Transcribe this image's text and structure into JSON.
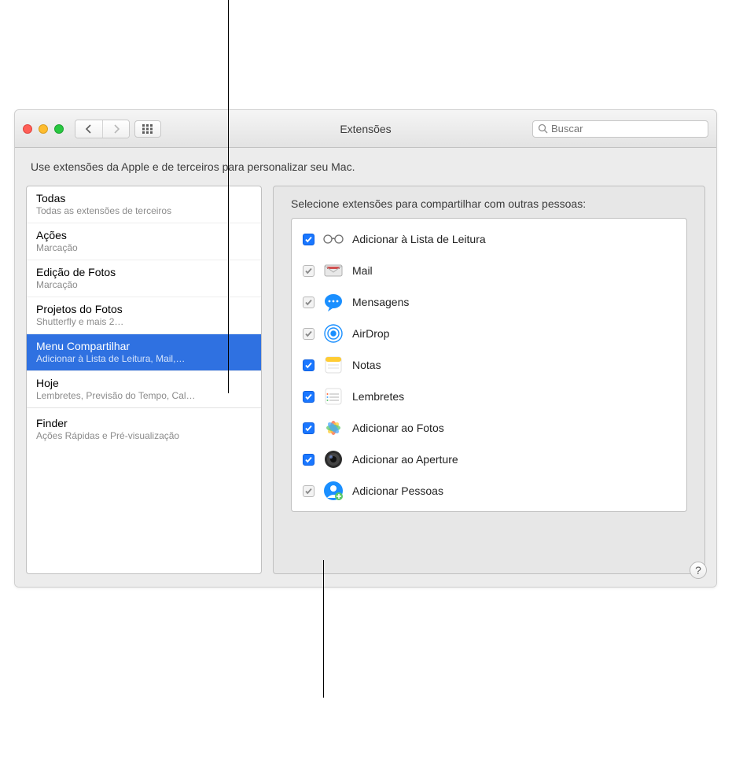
{
  "window": {
    "title": "Extensões",
    "search_placeholder": "Buscar"
  },
  "subheader": "Use extensões da Apple e de terceiros para personalizar seu Mac.",
  "sidebar": {
    "items": [
      {
        "title": "Todas",
        "subtitle": "Todas as extensões de terceiros"
      },
      {
        "title": "Ações",
        "subtitle": "Marcação"
      },
      {
        "title": "Edição de Fotos",
        "subtitle": "Marcação"
      },
      {
        "title": "Projetos do Fotos",
        "subtitle": "Shutterfly e mais 2…"
      },
      {
        "title": "Menu Compartilhar",
        "subtitle": "Adicionar à Lista de Leitura, Mail,…"
      },
      {
        "title": "Hoje",
        "subtitle": "Lembretes, Previsão do Tempo, Cal…"
      },
      {
        "title": "Finder",
        "subtitle": "Ações Rápidas e Pré-visualização"
      }
    ],
    "selected_index": 4
  },
  "main": {
    "header": "Selecione extensões para compartilhar com outras pessoas:",
    "extensions": [
      {
        "label": "Adicionar à Lista de Leitura",
        "checked": true,
        "locked": false,
        "icon": "glasses"
      },
      {
        "label": "Mail",
        "checked": true,
        "locked": true,
        "icon": "mail"
      },
      {
        "label": "Mensagens",
        "checked": true,
        "locked": true,
        "icon": "messages"
      },
      {
        "label": "AirDrop",
        "checked": true,
        "locked": true,
        "icon": "airdrop"
      },
      {
        "label": "Notas",
        "checked": true,
        "locked": false,
        "icon": "notes"
      },
      {
        "label": "Lembretes",
        "checked": true,
        "locked": false,
        "icon": "reminders"
      },
      {
        "label": "Adicionar ao Fotos",
        "checked": true,
        "locked": false,
        "icon": "photos"
      },
      {
        "label": "Adicionar ao Aperture",
        "checked": true,
        "locked": false,
        "icon": "aperture"
      },
      {
        "label": "Adicionar Pessoas",
        "checked": true,
        "locked": true,
        "icon": "addpeople"
      }
    ]
  }
}
